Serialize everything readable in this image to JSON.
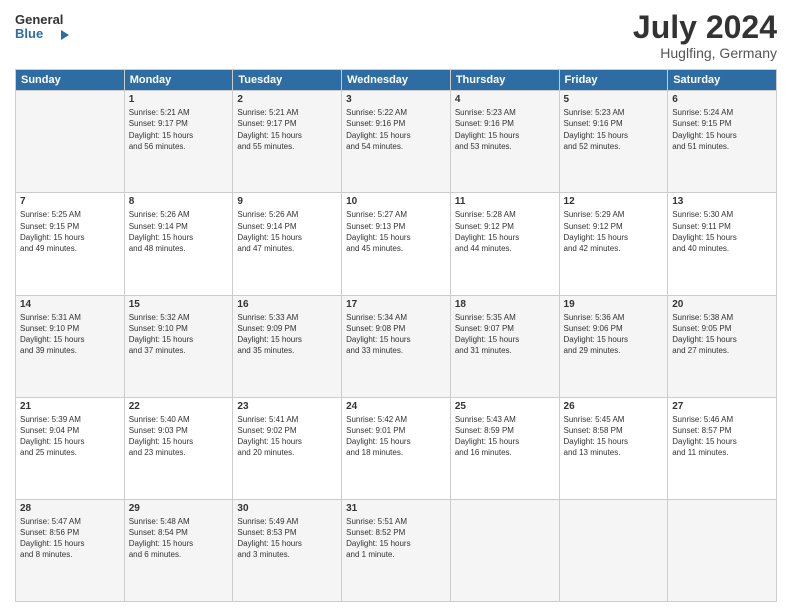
{
  "header": {
    "logo_line1": "General",
    "logo_line2": "Blue",
    "month_year": "July 2024",
    "location": "Huglfing, Germany"
  },
  "weekdays": [
    "Sunday",
    "Monday",
    "Tuesday",
    "Wednesday",
    "Thursday",
    "Friday",
    "Saturday"
  ],
  "weeks": [
    [
      {
        "day": "",
        "info": ""
      },
      {
        "day": "1",
        "info": "Sunrise: 5:21 AM\nSunset: 9:17 PM\nDaylight: 15 hours\nand 56 minutes."
      },
      {
        "day": "2",
        "info": "Sunrise: 5:21 AM\nSunset: 9:17 PM\nDaylight: 15 hours\nand 55 minutes."
      },
      {
        "day": "3",
        "info": "Sunrise: 5:22 AM\nSunset: 9:16 PM\nDaylight: 15 hours\nand 54 minutes."
      },
      {
        "day": "4",
        "info": "Sunrise: 5:23 AM\nSunset: 9:16 PM\nDaylight: 15 hours\nand 53 minutes."
      },
      {
        "day": "5",
        "info": "Sunrise: 5:23 AM\nSunset: 9:16 PM\nDaylight: 15 hours\nand 52 minutes."
      },
      {
        "day": "6",
        "info": "Sunrise: 5:24 AM\nSunset: 9:15 PM\nDaylight: 15 hours\nand 51 minutes."
      }
    ],
    [
      {
        "day": "7",
        "info": "Sunrise: 5:25 AM\nSunset: 9:15 PM\nDaylight: 15 hours\nand 49 minutes."
      },
      {
        "day": "8",
        "info": "Sunrise: 5:26 AM\nSunset: 9:14 PM\nDaylight: 15 hours\nand 48 minutes."
      },
      {
        "day": "9",
        "info": "Sunrise: 5:26 AM\nSunset: 9:14 PM\nDaylight: 15 hours\nand 47 minutes."
      },
      {
        "day": "10",
        "info": "Sunrise: 5:27 AM\nSunset: 9:13 PM\nDaylight: 15 hours\nand 45 minutes."
      },
      {
        "day": "11",
        "info": "Sunrise: 5:28 AM\nSunset: 9:12 PM\nDaylight: 15 hours\nand 44 minutes."
      },
      {
        "day": "12",
        "info": "Sunrise: 5:29 AM\nSunset: 9:12 PM\nDaylight: 15 hours\nand 42 minutes."
      },
      {
        "day": "13",
        "info": "Sunrise: 5:30 AM\nSunset: 9:11 PM\nDaylight: 15 hours\nand 40 minutes."
      }
    ],
    [
      {
        "day": "14",
        "info": "Sunrise: 5:31 AM\nSunset: 9:10 PM\nDaylight: 15 hours\nand 39 minutes."
      },
      {
        "day": "15",
        "info": "Sunrise: 5:32 AM\nSunset: 9:10 PM\nDaylight: 15 hours\nand 37 minutes."
      },
      {
        "day": "16",
        "info": "Sunrise: 5:33 AM\nSunset: 9:09 PM\nDaylight: 15 hours\nand 35 minutes."
      },
      {
        "day": "17",
        "info": "Sunrise: 5:34 AM\nSunset: 9:08 PM\nDaylight: 15 hours\nand 33 minutes."
      },
      {
        "day": "18",
        "info": "Sunrise: 5:35 AM\nSunset: 9:07 PM\nDaylight: 15 hours\nand 31 minutes."
      },
      {
        "day": "19",
        "info": "Sunrise: 5:36 AM\nSunset: 9:06 PM\nDaylight: 15 hours\nand 29 minutes."
      },
      {
        "day": "20",
        "info": "Sunrise: 5:38 AM\nSunset: 9:05 PM\nDaylight: 15 hours\nand 27 minutes."
      }
    ],
    [
      {
        "day": "21",
        "info": "Sunrise: 5:39 AM\nSunset: 9:04 PM\nDaylight: 15 hours\nand 25 minutes."
      },
      {
        "day": "22",
        "info": "Sunrise: 5:40 AM\nSunset: 9:03 PM\nDaylight: 15 hours\nand 23 minutes."
      },
      {
        "day": "23",
        "info": "Sunrise: 5:41 AM\nSunset: 9:02 PM\nDaylight: 15 hours\nand 20 minutes."
      },
      {
        "day": "24",
        "info": "Sunrise: 5:42 AM\nSunset: 9:01 PM\nDaylight: 15 hours\nand 18 minutes."
      },
      {
        "day": "25",
        "info": "Sunrise: 5:43 AM\nSunset: 8:59 PM\nDaylight: 15 hours\nand 16 minutes."
      },
      {
        "day": "26",
        "info": "Sunrise: 5:45 AM\nSunset: 8:58 PM\nDaylight: 15 hours\nand 13 minutes."
      },
      {
        "day": "27",
        "info": "Sunrise: 5:46 AM\nSunset: 8:57 PM\nDaylight: 15 hours\nand 11 minutes."
      }
    ],
    [
      {
        "day": "28",
        "info": "Sunrise: 5:47 AM\nSunset: 8:56 PM\nDaylight: 15 hours\nand 8 minutes."
      },
      {
        "day": "29",
        "info": "Sunrise: 5:48 AM\nSunset: 8:54 PM\nDaylight: 15 hours\nand 6 minutes."
      },
      {
        "day": "30",
        "info": "Sunrise: 5:49 AM\nSunset: 8:53 PM\nDaylight: 15 hours\nand 3 minutes."
      },
      {
        "day": "31",
        "info": "Sunrise: 5:51 AM\nSunset: 8:52 PM\nDaylight: 15 hours\nand 1 minute."
      },
      {
        "day": "",
        "info": ""
      },
      {
        "day": "",
        "info": ""
      },
      {
        "day": "",
        "info": ""
      }
    ]
  ]
}
